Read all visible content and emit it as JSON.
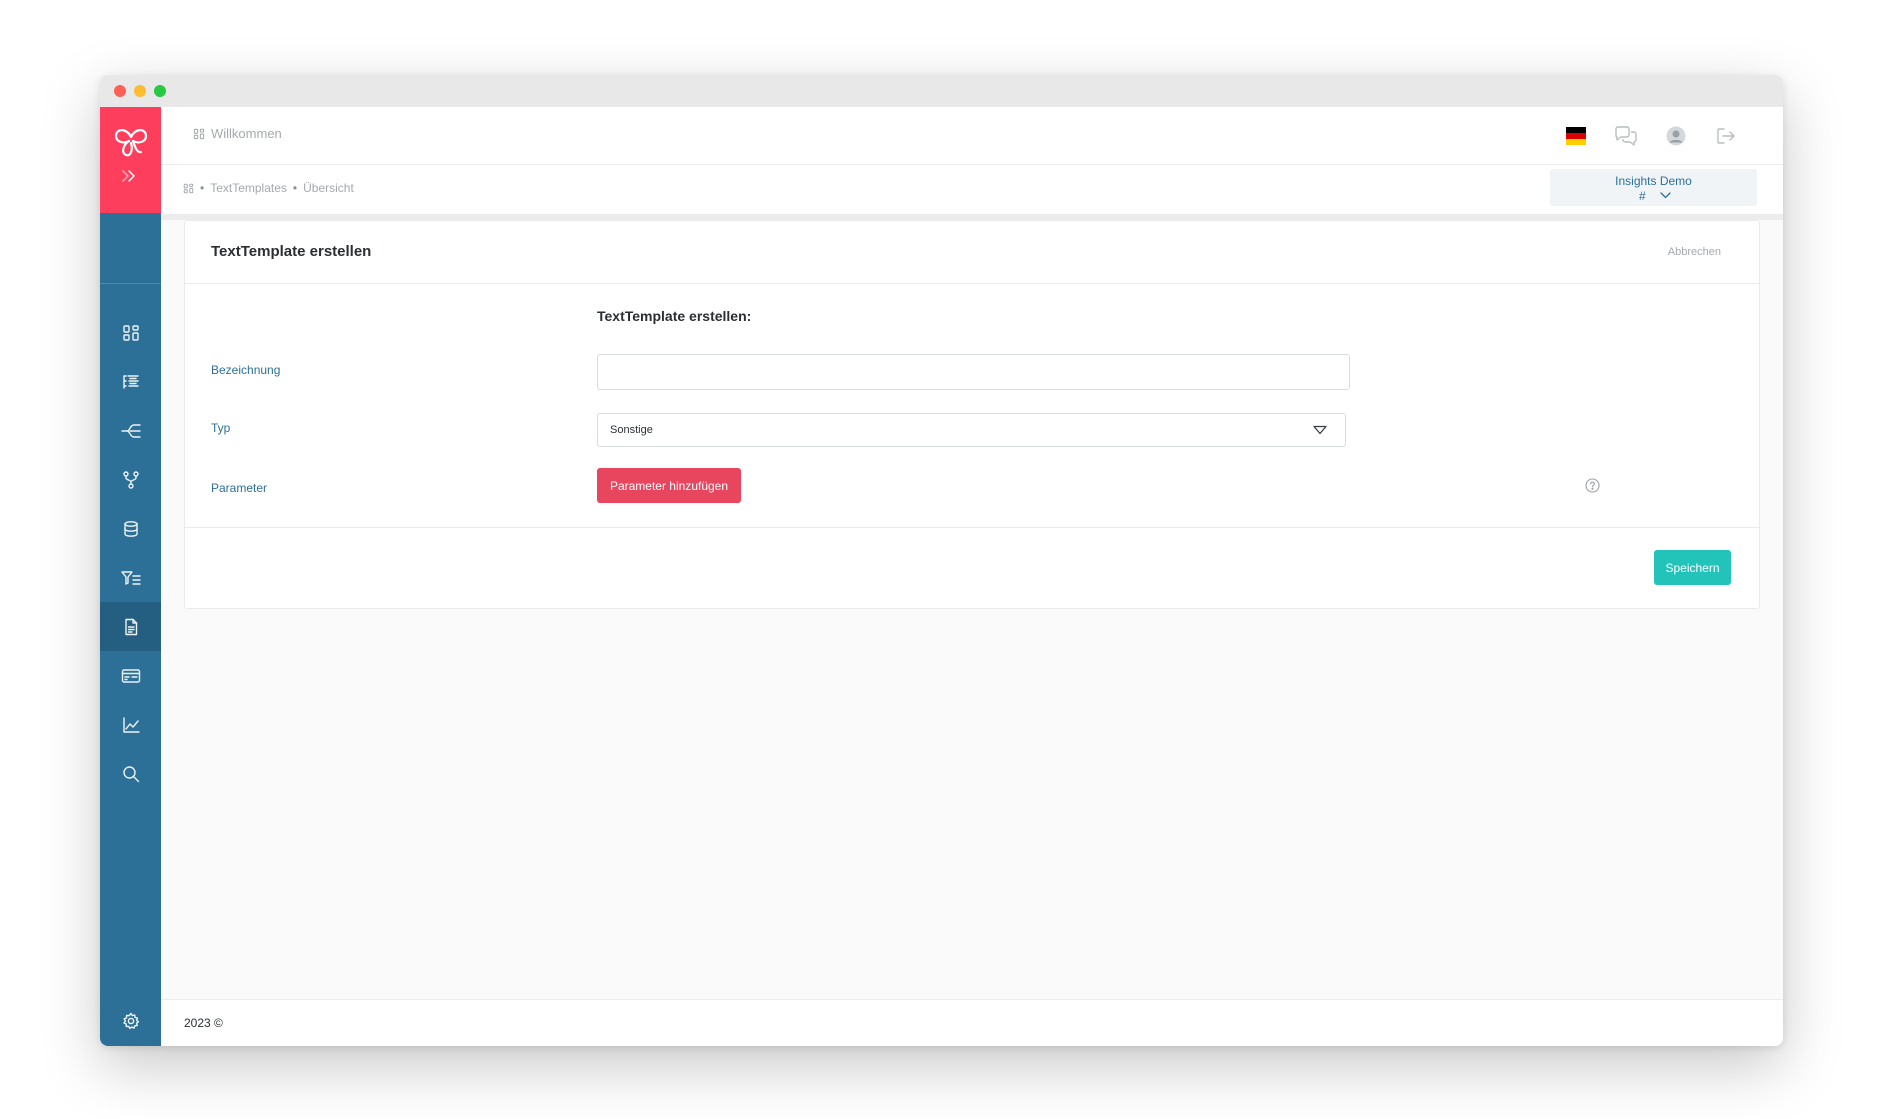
{
  "colors": {
    "brand": "#fe3e5d",
    "sidebar": "#2c7097",
    "primary_button": "#e8455f",
    "save_button": "#22c4b9"
  },
  "header": {
    "welcome": "Willkommen",
    "icons": [
      "german-flag-icon",
      "chat-icon",
      "user-avatar-icon",
      "logout-icon"
    ]
  },
  "breadcrumb": {
    "items": [
      "TextTemplates",
      "Übersicht"
    ]
  },
  "project_selector": {
    "name": "Insights Demo",
    "id": "#"
  },
  "sidebar": {
    "items": [
      "dashboard-icon",
      "list-icon",
      "flow-icon",
      "branch-icon",
      "database-icon",
      "filter-icon",
      "document-icon",
      "card-icon",
      "chart-icon",
      "search-icon"
    ],
    "active": "document-icon",
    "bottom": "settings-icon"
  },
  "card": {
    "title": "TextTemplate erstellen",
    "cancel": "Abbrechen",
    "form_title": "TextTemplate erstellen:",
    "fields": {
      "name_label": "Bezeichnung",
      "name_value": "",
      "type_label": "Typ",
      "type_value": "Sonstige",
      "params_label": "Parameter",
      "add_param_button": "Parameter hinzufügen"
    },
    "save_button": "Speichern"
  },
  "footer": {
    "text": "2023 ©"
  }
}
